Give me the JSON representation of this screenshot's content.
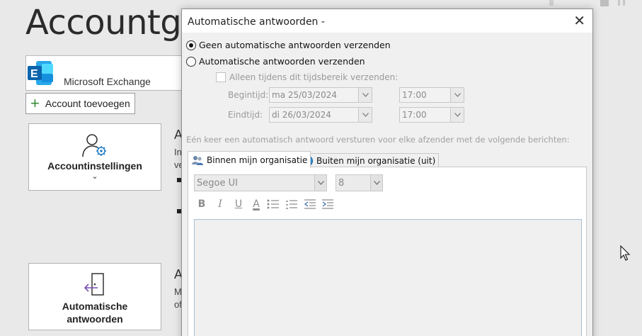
{
  "backstage": {
    "title": "Accountgeg",
    "account_name": "Microsoft Exchange",
    "add_account_label": "Account toevoegen",
    "tile_settings_label": "Accountinstellingen",
    "tile_settings_chevron": "⌄",
    "tile_auto_label_1": "Automatische",
    "tile_auto_label_2": "antwoorden",
    "side_heading_1": "A",
    "side_line_1a": "In",
    "side_line_1b": "ve",
    "side_heading_2": "A",
    "side_line_2a": "M",
    "side_line_2b": "of",
    "exchange_icon_letter": "E"
  },
  "dialog": {
    "title": "Automatische antwoorden -",
    "close_label": "✕",
    "radio_no_reply": "Geen automatische antwoorden verzenden",
    "radio_send_reply": "Automatische antwoorden verzenden",
    "radio_selected": "no_reply",
    "checkbox_timerange": "Alleen tijdens dit tijdsbereik verzenden:",
    "start_label": "Begintijd:",
    "start_date": "ma 25/03/2024",
    "start_time": "17:00",
    "end_label": "Eindtijd:",
    "end_date": "di 26/03/2024",
    "end_time": "17:00",
    "note": "Eén keer een automatisch antwoord versturen voor elke afzender met de volgende berichten:",
    "tab_inside": "Binnen mijn organisatie",
    "tab_outside": "Buiten mijn organisatie (uit)",
    "font_name": "Segoe UI",
    "font_size": "8",
    "format_bold": "B",
    "format_italic": "I",
    "format_underline": "U",
    "format_color": "A"
  },
  "colors": {
    "exchange_blue": "#0a64ad",
    "exchange_light": "#28a8ea",
    "add_plus": "#3a8a3a",
    "editor_border": "#a9bfd2"
  }
}
